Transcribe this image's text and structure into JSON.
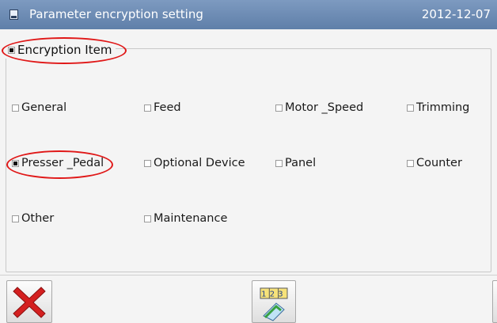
{
  "titlebar": {
    "icon": "document-icon",
    "title": "Parameter encryption setting",
    "date": "2012-12-07"
  },
  "section": {
    "label": "Encryption Item",
    "checked": true
  },
  "items": [
    {
      "label": "General",
      "checked": false
    },
    {
      "label": "Feed",
      "checked": false
    },
    {
      "label": "Motor _Speed",
      "checked": false
    },
    {
      "label": "Trimming",
      "checked": false
    },
    {
      "label": "Presser _Pedal",
      "checked": true
    },
    {
      "label": "Optional Device",
      "checked": false
    },
    {
      "label": "Panel",
      "checked": false
    },
    {
      "label": "Counter",
      "checked": false
    },
    {
      "label": "Other",
      "checked": false
    },
    {
      "label": "Maintenance",
      "checked": false
    }
  ],
  "toolbar": {
    "cancel_icon": "close-icon",
    "numbering_icon": "number-keypad-icon",
    "numbering_digits": "123"
  },
  "colors": {
    "titlebar": "#6a88b2",
    "annotation": "#e01818",
    "cancel": "#d42020"
  }
}
